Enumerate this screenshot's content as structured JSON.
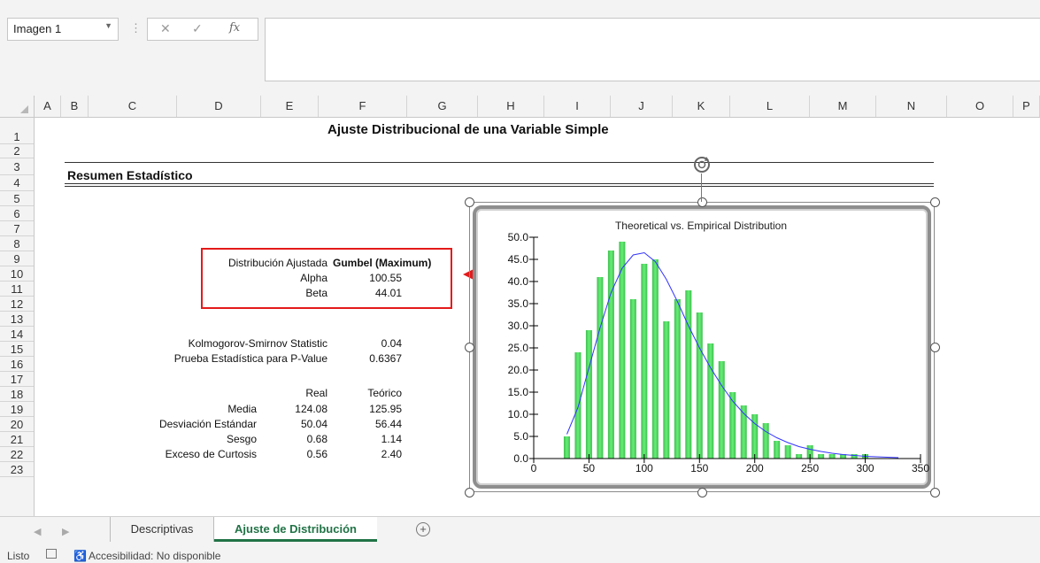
{
  "name_box": {
    "value": "Imagen 1",
    "dropdown_icon": "caret-down-icon"
  },
  "formula_bar": {
    "cancel_icon": "✕",
    "enter_icon": "✓",
    "fx_label": "fx",
    "formula": ""
  },
  "columns": [
    "A",
    "B",
    "C",
    "D",
    "E",
    "F",
    "G",
    "H",
    "I",
    "J",
    "K",
    "L",
    "M",
    "N",
    "O",
    "P"
  ],
  "rows": [
    "1",
    "2",
    "3",
    "4",
    "5",
    "6",
    "7",
    "8",
    "9",
    "10",
    "11",
    "12",
    "13",
    "14",
    "15",
    "16",
    "17",
    "18",
    "19",
    "20",
    "21",
    "22",
    "23"
  ],
  "sheet": {
    "title": "Ajuste Distribucional de una Variable Simple",
    "section_title": "Resumen Estadístico",
    "fit": {
      "label": "Distribución Ajustada",
      "value": "Gumbel (Maximum)",
      "params": [
        {
          "label": "Alpha",
          "value": "100.55"
        },
        {
          "label": "Beta",
          "value": "44.01"
        }
      ]
    },
    "tests": [
      {
        "label": "Kolmogorov-Smirnov Statistic",
        "value": "0.04"
      },
      {
        "label": "Prueba Estadística para P-Value",
        "value": "0.6367"
      }
    ],
    "stats": {
      "col_real": "Real",
      "col_teorico": "Teórico",
      "rows": [
        {
          "label": "Media",
          "real": "124.08",
          "teorico": "125.95"
        },
        {
          "label": "Desviación Estándar",
          "real": "50.04",
          "teorico": "56.44"
        },
        {
          "label": "Sesgo",
          "real": "0.68",
          "teorico": "1.14"
        },
        {
          "label": "Exceso de Curtosis",
          "real": "0.56",
          "teorico": "2.40"
        }
      ]
    }
  },
  "chart_data": {
    "type": "bar",
    "title": "Theoretical vs. Empirical Distribution",
    "xlim": [
      0,
      350
    ],
    "ylim": [
      0,
      50
    ],
    "xticks": [
      0,
      50,
      100,
      150,
      200,
      250,
      300,
      350
    ],
    "xtick_labels": [
      "0",
      "50",
      "100",
      "150",
      "200",
      "250",
      "300",
      "350"
    ],
    "yticks": [
      0,
      5,
      10,
      15,
      20,
      25,
      30,
      35,
      40,
      45,
      50
    ],
    "ytick_labels": [
      "0.0",
      "5.0",
      "10.0",
      "15.0",
      "20.0",
      "25.0",
      "30.0",
      "35.0",
      "40.0",
      "45.0",
      "50.0"
    ],
    "bar_color": "#66ee77",
    "curve_color": "#3333ff",
    "series": [
      {
        "kind": "bars",
        "x": [
          30,
          40,
          50,
          60,
          70,
          80,
          90,
          100,
          110,
          120,
          130,
          140,
          150,
          160,
          170,
          180,
          190,
          200,
          210,
          220,
          230,
          240,
          250,
          260,
          270,
          280,
          290,
          300,
          310,
          320
        ],
        "values": [
          5,
          24,
          29,
          41,
          47,
          49,
          36,
          44,
          45,
          31,
          36,
          38,
          33,
          26,
          22,
          15,
          12,
          10,
          8,
          4,
          3,
          1,
          3,
          1,
          1,
          1,
          1,
          1,
          0,
          0
        ]
      },
      {
        "kind": "curve",
        "x": [
          30,
          40,
          50,
          60,
          70,
          80,
          90,
          100,
          110,
          120,
          130,
          140,
          150,
          160,
          170,
          180,
          190,
          200,
          210,
          220,
          230,
          240,
          250,
          260,
          270,
          280,
          290,
          300,
          310,
          320,
          330
        ],
        "values": [
          5.5,
          11.5,
          20.5,
          29.5,
          37.5,
          43,
          46,
          46.5,
          44.5,
          40.5,
          35.5,
          30,
          25,
          20.5,
          16.5,
          13,
          10.2,
          7.9,
          6.1,
          4.7,
          3.6,
          2.7,
          2.1,
          1.6,
          1.2,
          0.9,
          0.7,
          0.5,
          0.4,
          0.3,
          0.2
        ]
      }
    ]
  },
  "tabs": [
    {
      "label": "Descriptivas",
      "active": false
    },
    {
      "label": "Ajuste de Distribución",
      "active": true
    }
  ],
  "add_sheet_icon": "plus-circle-icon",
  "status": {
    "ready": "Listo",
    "accessibility": "Accesibilidad: No disponible"
  },
  "colors": {
    "accent": "#217346",
    "highlight": "#e41a1a"
  }
}
